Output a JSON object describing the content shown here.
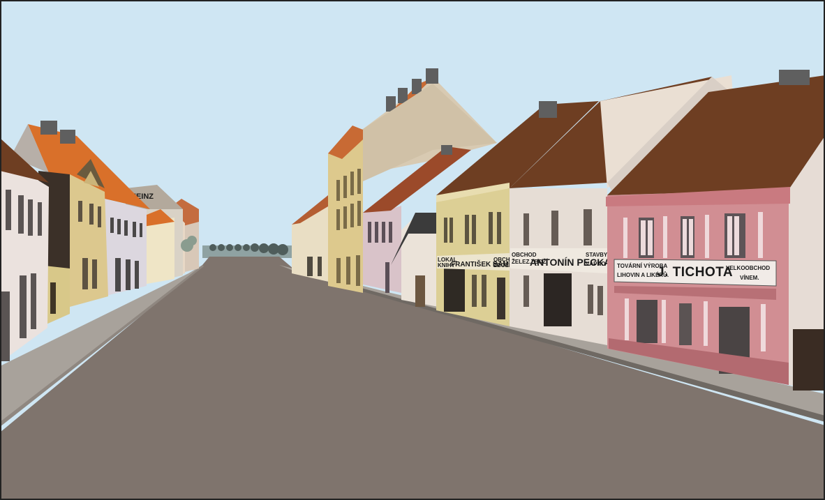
{
  "scene": {
    "signs": {
      "left_building": "HEINZ",
      "bambas": {
        "left_small_1": "LOKAL",
        "left_small_2": "KNIHY",
        "name": "FRANTIŠEK BAMBAS.",
        "right_small_1": "OBCHOD",
        "right_small_2": "ZBOŽÍM"
      },
      "pecka": {
        "left_small_1": "OBCHOD",
        "left_small_2": "ŽELEZ.ZBOŽÍ",
        "name": "ANTONÍN PECKA.",
        "right_small_1": "STAVBY A",
        "right_small_2": "VÁPNO"
      },
      "tichota": {
        "left_small_1": "TOVÁRNÍ VÝROBA",
        "left_small_2": "LIHOVIN A LIKÉRŮ.",
        "name": "J. TICHOTA",
        "right_small_1": "VELKOOBCHOD",
        "right_small_2": "VÍNEM."
      }
    },
    "colors": {
      "sky": "#cfe6f3",
      "road": "#7f746d",
      "sidewalk": "#a8a29b",
      "roof_brown": "#6e3e22",
      "roof_orange": "#d9702a",
      "facade_pink": "#d18e93",
      "facade_cream": "#e9dec4",
      "facade_yellow": "#dcc88e",
      "frame": "#222222"
    }
  }
}
